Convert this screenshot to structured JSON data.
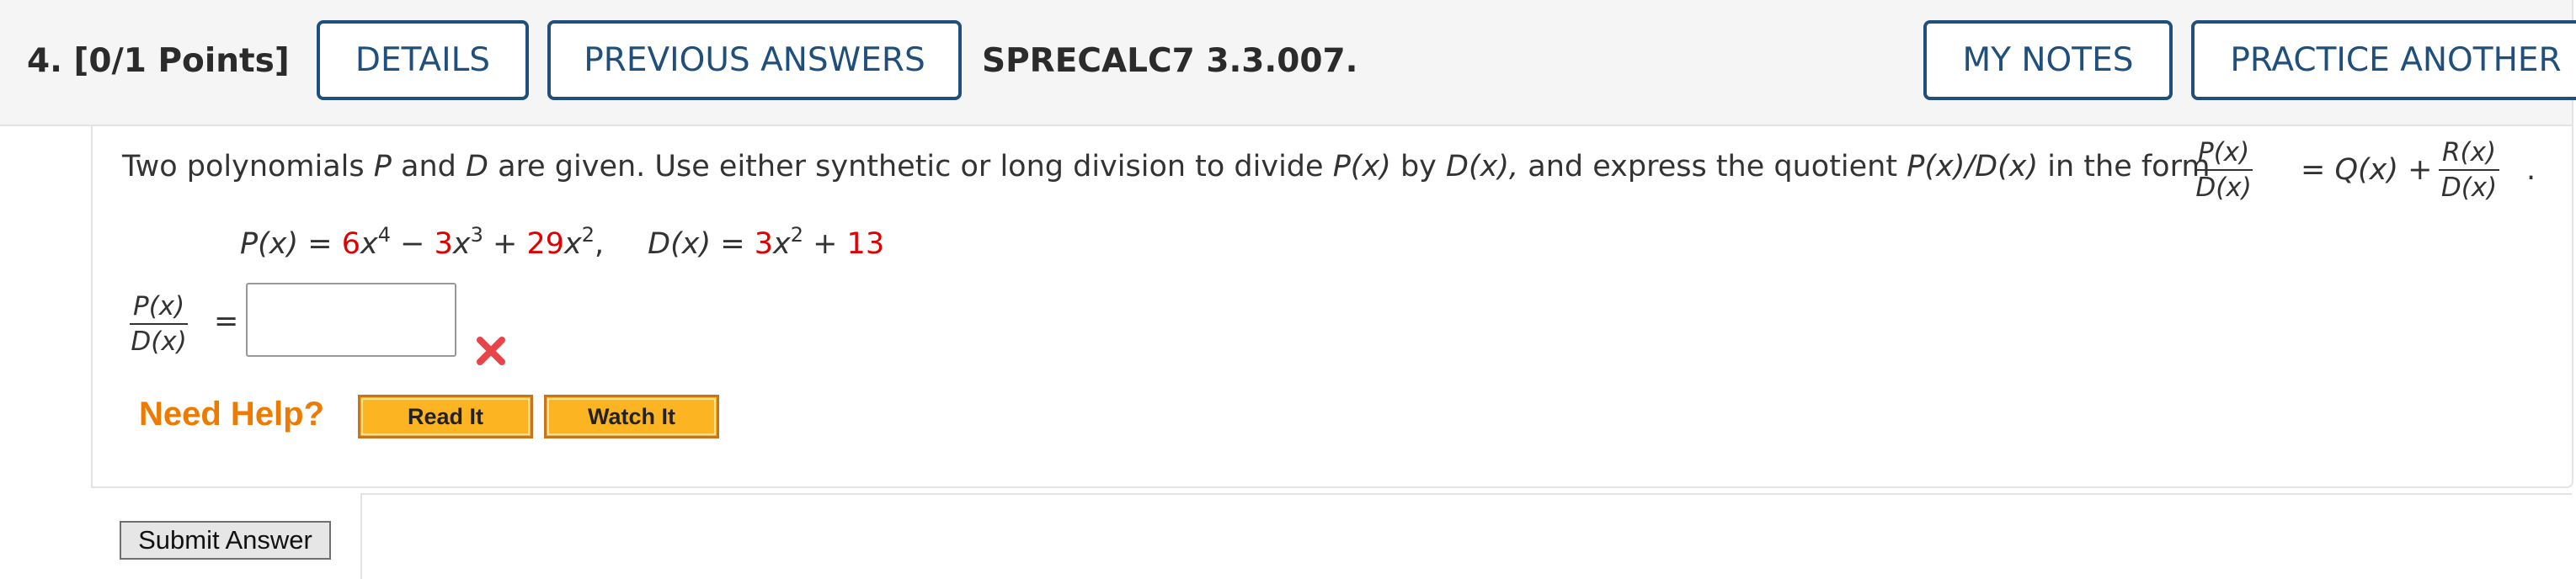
{
  "header": {
    "question_number": "4. [0/1 Points]",
    "details_label": "DETAILS",
    "previous_answers_label": "PREVIOUS ANSWERS",
    "question_code": "SPRECALC7 3.3.007.",
    "my_notes_label": "MY NOTES",
    "practice_another_label": "PRACTICE ANOTHER"
  },
  "question": {
    "prompt_part1": "Two polynomials ",
    "prompt_P": "P",
    "prompt_and": " and ",
    "prompt_D": "D",
    "prompt_part2": " are given. Use either synthetic or long division to divide ",
    "prompt_Px": "P(x)",
    "prompt_by": " by ",
    "prompt_Dx": "D(x),",
    "prompt_part3": " and express the quotient ",
    "prompt_PxDx": "P(x)/D(x)",
    "prompt_part4": " in the form",
    "form_numerator": "P(x)",
    "form_denominator": "D(x)",
    "form_middle": "= Q(x) +",
    "form_numerator2": "R(x)",
    "form_denominator2": "D(x)",
    "form_period": "."
  },
  "equation": {
    "Px_label": "P(x)",
    "eq_sign": " = ",
    "term1_coef": "6",
    "term1_var": "x",
    "term1_exp": "4",
    "minus": " − ",
    "term2_coef": "3",
    "term2_var": "x",
    "term2_exp": "3",
    "plus": " + ",
    "term3_coef": "29",
    "term3_var": "x",
    "term3_exp": "2",
    "comma": ",",
    "Dx_label": "D(x)",
    "eq_sign2": " = ",
    "d_term1_coef": "3",
    "d_term1_var": "x",
    "d_term1_exp": "2",
    "plus2": " + ",
    "d_const": "13"
  },
  "answer": {
    "lhs_numerator": "P(x)",
    "lhs_denominator": "D(x)",
    "equals": "=",
    "input_value": "",
    "status": "incorrect"
  },
  "help": {
    "label": "Need Help?",
    "read_it_label": "Read It",
    "watch_it_label": "Watch It"
  },
  "submit_label": "Submit Answer",
  "colors": {
    "accent_blue": "#1f4f7d",
    "error_red": "#e8454b",
    "help_orange": "#ee7a00",
    "button_gold": "#fcb422",
    "highlight_red": "#e00000"
  }
}
